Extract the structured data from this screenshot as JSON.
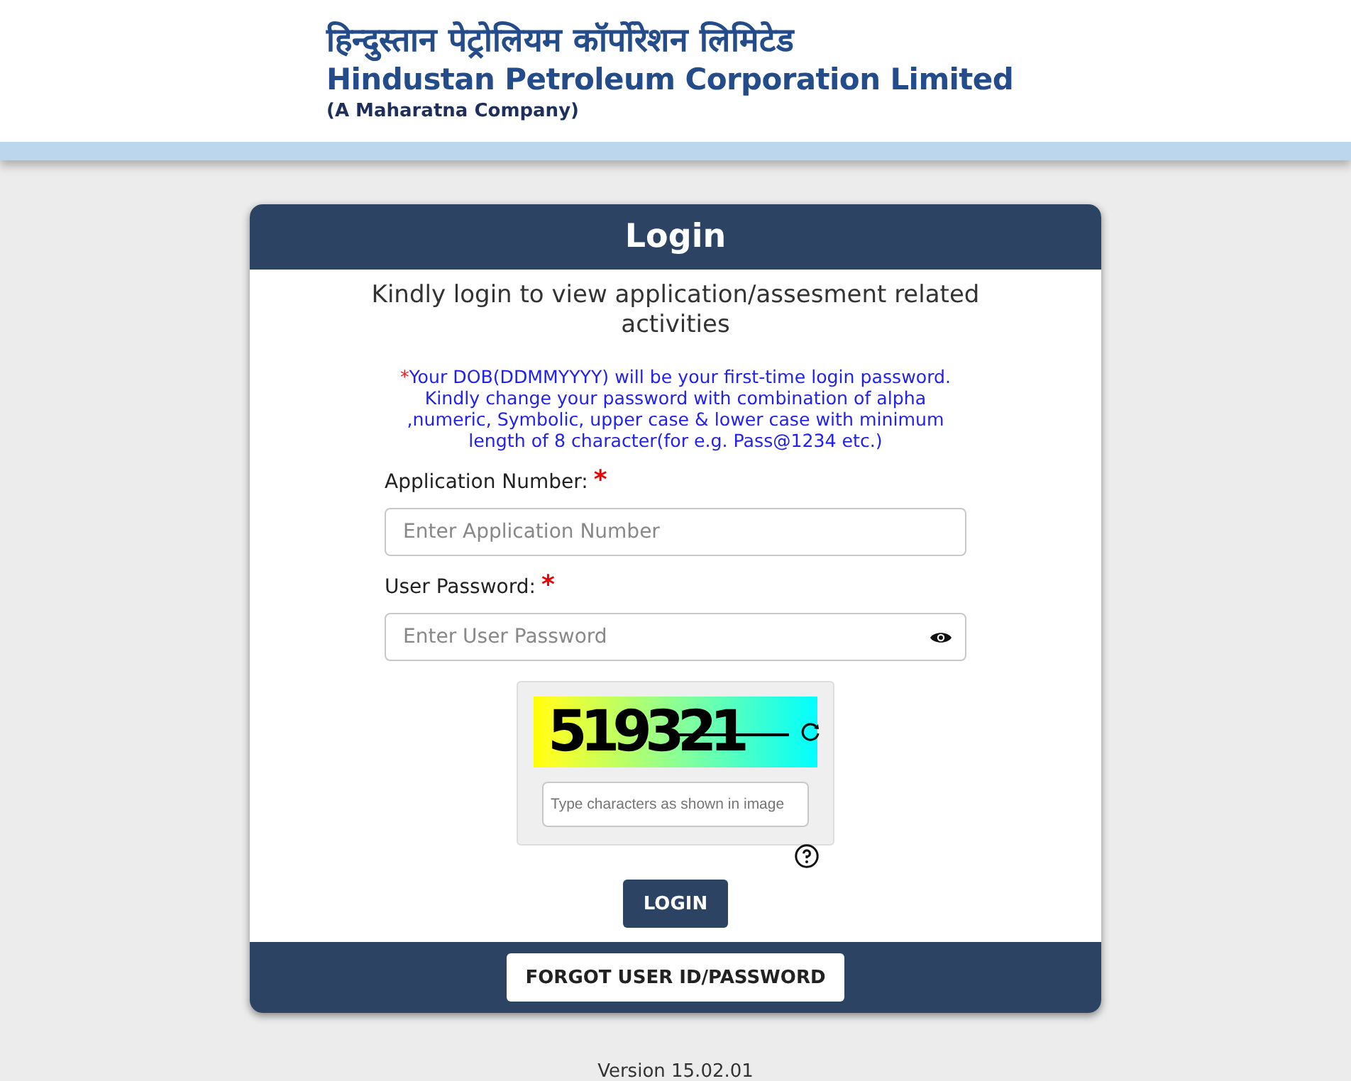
{
  "header": {
    "hindi_name": "हिन्दुस्तान पेट्रोलियम कॉर्पोरेशन लिमिटेड",
    "english_name": "Hindustan Petroleum Corporation Limited",
    "tagline": "(A Maharatna Company)"
  },
  "login": {
    "title": "Login",
    "intro": "Kindly login to view application/assesment related activities",
    "note": {
      "mark": "*",
      "text": "Your DOB(DDMMYYYY) will be your first-time login password. Kindly change your password with combination of alpha ,numeric, Symbolic, upper case & lower case with minimum length of 8 character(for e.g. Pass@1234 etc.)"
    },
    "fields": [
      {
        "kind": "text",
        "label": "Application Number:",
        "required_mark": "*",
        "placeholder": "Enter Application Number"
      },
      {
        "kind": "password",
        "label": "User Password:",
        "required_mark": "*",
        "placeholder": "Enter User Password"
      }
    ],
    "captcha": {
      "code": "519321",
      "placeholder": "Type characters as shown in image"
    },
    "login_button": "LOGIN",
    "forgot_button": "FORGOT USER ID/PASSWORD"
  },
  "version": "Version 15.02.01"
}
